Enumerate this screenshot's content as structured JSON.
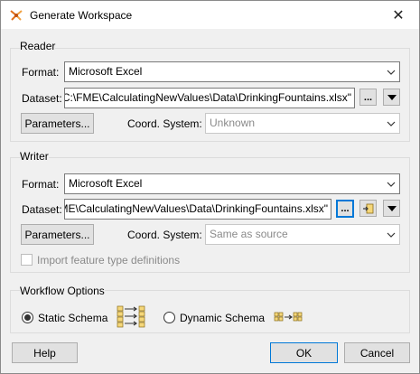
{
  "window": {
    "title": "Generate Workspace",
    "close_glyph": "✕"
  },
  "reader": {
    "group_label": "Reader",
    "format_label": "Format:",
    "format_value": "Microsoft Excel",
    "dataset_label": "Dataset:",
    "dataset_value": "C:\\FME\\CalculatingNewValues\\Data\\DrinkingFountains.xlsx\"",
    "browse_label": "...",
    "parameters_label": "Parameters...",
    "coord_label": "Coord. System:",
    "coord_value": "Unknown"
  },
  "writer": {
    "group_label": "Writer",
    "format_label": "Format:",
    "format_value": "Microsoft Excel",
    "dataset_label": "Dataset:",
    "dataset_value": "C:\\FME\\CalculatingNewValues\\Data\\DrinkingFountains.xlsx\"",
    "browse_label": "...",
    "parameters_label": "Parameters...",
    "coord_label": "Coord. System:",
    "coord_value": "Same as source",
    "import_label": "Import feature type definitions"
  },
  "workflow": {
    "group_label": "Workflow Options",
    "static_label": "Static Schema",
    "dynamic_label": "Dynamic Schema",
    "selected": "static"
  },
  "footer": {
    "help_label": "Help",
    "ok_label": "OK",
    "cancel_label": "Cancel"
  }
}
